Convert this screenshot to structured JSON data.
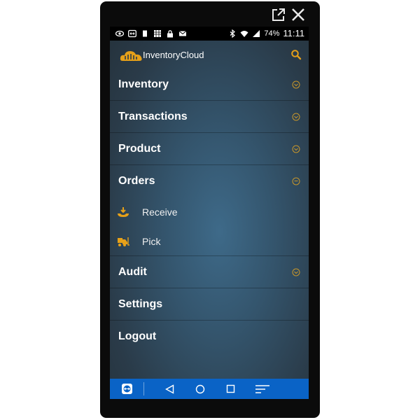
{
  "window_controls": {
    "popout_icon": "popout-icon",
    "close_icon": "close-icon"
  },
  "status_bar": {
    "left_icons": [
      "eye-icon",
      "teamviewer-icon",
      "sd-card-icon",
      "keyboard-icon",
      "lock-icon",
      "mail-icon"
    ],
    "right_icons": [
      "bluetooth-icon",
      "wifi-icon",
      "signal-icon"
    ],
    "battery": "74%",
    "time": "11:11"
  },
  "app_bar": {
    "title": "InventoryCloud",
    "logo_icon": "cloud-logo-icon",
    "search_icon": "search-icon"
  },
  "menu": {
    "inventory": "Inventory",
    "transactions": "Transactions",
    "product": "Product",
    "orders": "Orders",
    "receive": "Receive",
    "pick": "Pick",
    "audit": "Audit",
    "settings": "Settings",
    "logout": "Logout"
  },
  "nav_bar": {
    "icons": [
      "teamviewer-icon",
      "back-icon",
      "home-icon",
      "recents-icon",
      "menu-icon"
    ]
  },
  "colors": {
    "accent": "#e6a019",
    "nav_bar": "#0a63c6",
    "status_bar": "#000000"
  }
}
